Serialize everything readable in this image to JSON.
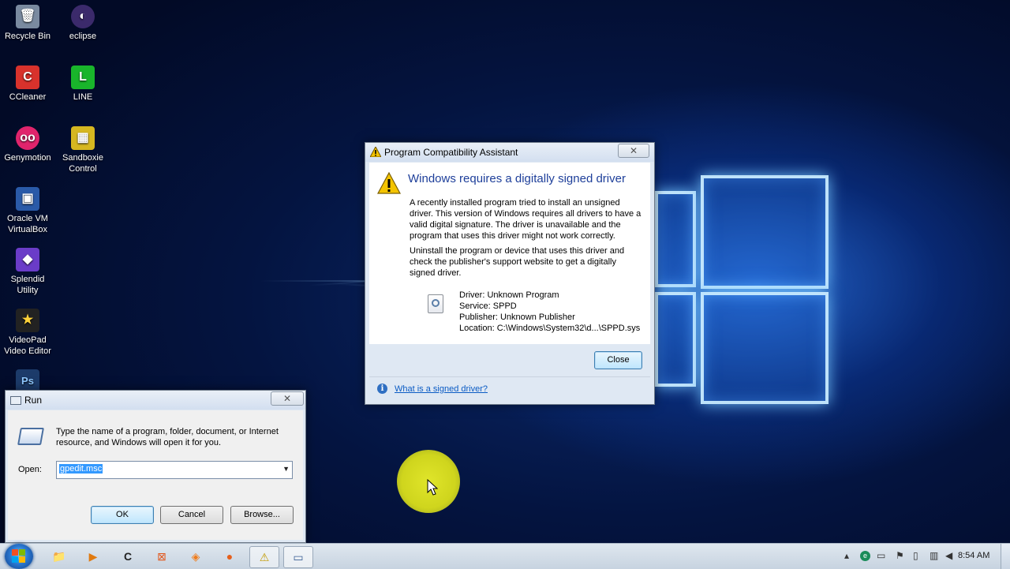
{
  "desktop": {
    "icons": [
      {
        "label": "Recycle Bin",
        "icon": "recycle-bin-icon",
        "glyph": "🗑",
        "color": "#7a8aa0"
      },
      {
        "label": "eclipse",
        "icon": "eclipse-icon",
        "glyph": "◐",
        "color": "#3b2a6b"
      },
      {
        "label": "CCleaner",
        "icon": "ccleaner-icon",
        "glyph": "C",
        "color": "#d8322c"
      },
      {
        "label": "LINE",
        "icon": "line-icon",
        "glyph": "L",
        "color": "#19b52b"
      },
      {
        "label": "Genymotion",
        "icon": "genymotion-icon",
        "glyph": "oo",
        "color": "#e0246c"
      },
      {
        "label": "Sandboxie Control",
        "icon": "sandboxie-icon",
        "glyph": "▦",
        "color": "#d6b720"
      },
      {
        "label": "Oracle VM VirtualBox",
        "icon": "virtualbox-icon",
        "glyph": "▣",
        "color": "#2a5aa8"
      },
      {
        "label": "Splendid Utility",
        "icon": "splendid-icon",
        "glyph": "◆",
        "color": "#6a3cc8"
      },
      {
        "label": "VideoPad Video Editor",
        "icon": "videopad-icon",
        "glyph": "★",
        "color": "#222222"
      },
      {
        "label": "",
        "icon": "photoshop-icon",
        "glyph": "Ps",
        "color": "#1c3b6a"
      }
    ]
  },
  "pca": {
    "title": "Program Compatibility Assistant",
    "close_x": "✕",
    "heading": "Windows requires a digitally signed driver",
    "para1": "A recently installed program tried to install an unsigned driver. This version of Windows requires all drivers to have a valid digital signature. The driver is unavailable and the program that uses this driver might not work correctly.",
    "para2": "Uninstall the program or device that uses this driver and check the publisher's support website to get a digitally signed driver.",
    "details": [
      "Driver: Unknown Program",
      "Service: SPPD",
      "Publisher: Unknown Publisher",
      "Location: C:\\Windows\\System32\\d...\\SPPD.sys"
    ],
    "close_label": "Close",
    "link": "What is a signed driver?"
  },
  "run": {
    "title": "Run",
    "close_x": "✕",
    "description": "Type the name of a program, folder, document, or Internet resource, and Windows will open it for you.",
    "open_label": "Open:",
    "open_value": "gpedit.msc",
    "ok_label": "OK",
    "cancel_label": "Cancel",
    "browse_label": "Browse..."
  },
  "taskbar": {
    "items": [
      {
        "icon": "explorer-icon",
        "glyph": "📁"
      },
      {
        "icon": "media-player-icon",
        "glyph": "▶"
      },
      {
        "icon": "ccleaner-icon",
        "glyph": "C"
      },
      {
        "icon": "xampp-icon",
        "glyph": "⊠"
      },
      {
        "icon": "app-icon",
        "glyph": "◈"
      },
      {
        "icon": "firefox-icon",
        "glyph": "●"
      },
      {
        "icon": "warning-icon",
        "glyph": "⚠"
      },
      {
        "icon": "run-icon",
        "glyph": "▭"
      }
    ],
    "clock": "8:54 AM"
  },
  "colors": {
    "link": "#0a5bc4",
    "heading": "#1e3f9a",
    "cursor_highlight": "#d7dc1e"
  }
}
